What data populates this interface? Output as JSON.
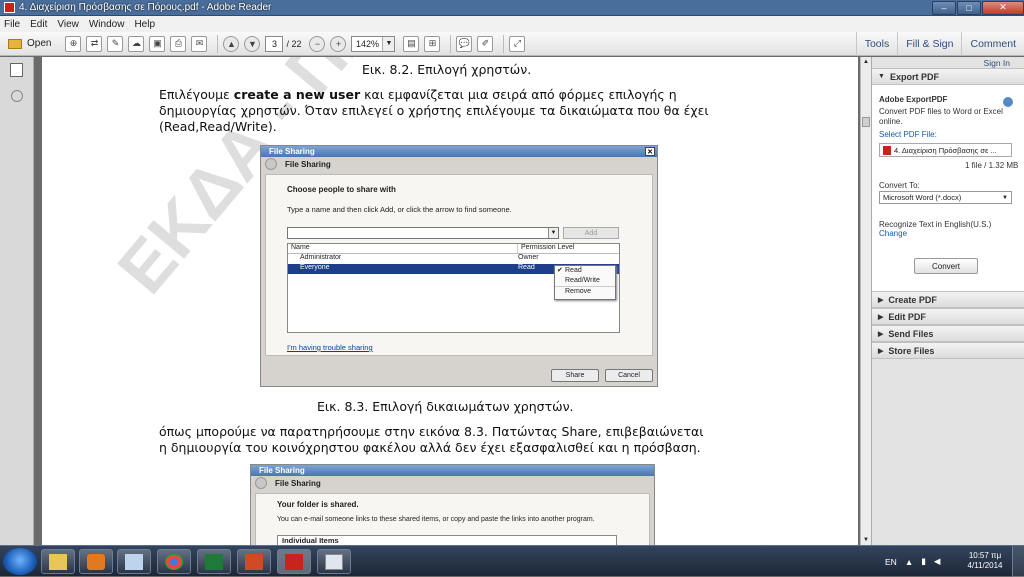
{
  "window": {
    "title": "4. Διαχείριση Πρόσβασης σε Πόρους.pdf - Adobe Reader",
    "min": "–",
    "max": "□",
    "close": "✕"
  },
  "menu": [
    "File",
    "Edit",
    "View",
    "Window",
    "Help"
  ],
  "toolbar": {
    "open_label": "Open",
    "page_current": "3",
    "page_total": "/ 22",
    "zoom": "142%",
    "tools": "Tools",
    "fill_sign": "Fill & Sign",
    "comment": "Comment"
  },
  "document": {
    "caption1": "Εικ. 8.2. Επιλογή χρηστών.",
    "para1_line1_pre": "Επιλέγουμε ",
    "para1_line1_bold": "create a new user",
    "para1_line1_post": " και εμφανίζεται  μια σειρά από φόρμες επιλογής η",
    "para1_line2": "δημιουργίας χρηστών. Όταν επιλεγεί ο χρήστης επιλέγουμε τα δικαιώματα που θα έχει",
    "para1_line3": "(Read,Read/Write).",
    "caption2": "Εικ. 8.3. Επιλογή δικαιωμάτων χρηστών.",
    "para2_line1": "όπως μπορούμε να παρατηρήσουμε στην εικόνα 8.3. Πατώντας Share, επιβεβαιώνεται",
    "para2_line2": "η δημιουργία του κοινόχρηστου φακέλου αλλά δεν έχει εξασφαλισθεί και η πρόσβαση.",
    "watermark": "ΕΚΔΑ - ΠΑΝΕΠΙΣΤΗΜΙΟ"
  },
  "dialog1": {
    "title": "File Sharing",
    "nav_title": "File Sharing",
    "heading": "Choose people to share with",
    "instructions": "Type a name and then click Add, or click the arrow to find someone.",
    "add_button": "Add",
    "col_name": "Name",
    "col_permission": "Permission Level",
    "rows": [
      {
        "name": "Administrator",
        "permission": "Owner"
      },
      {
        "name": "Everyone",
        "permission": "Read"
      }
    ],
    "menu_items": [
      "Read",
      "Read/Write",
      "Remove"
    ],
    "menu_check": "✔",
    "trouble_link": "I'm having trouble sharing",
    "share_button": "Share",
    "cancel_button": "Cancel"
  },
  "dialog2": {
    "title": "File Sharing",
    "nav_title": "File Sharing",
    "heading": "Your folder is shared.",
    "line": "You can e-mail someone links to these shared items, or copy and paste the links into another program.",
    "items_header": "Individual Items"
  },
  "right_panel": {
    "sign_in": "Sign In",
    "export_pdf": "Export PDF",
    "adobe_export": "Adobe ExportPDF",
    "convert_desc": "Convert PDF files to Word or Excel online.",
    "select_label": "Select PDF File:",
    "file_name": "4. Διαχείριση Πρόσβασης σε ...",
    "file_info": "1 file / 1.32 MB",
    "convert_to": "Convert To:",
    "format": "Microsoft Word (*.docx)",
    "recognize": "Recognize Text in English(U.S.)",
    "change": "Change",
    "convert_button": "Convert",
    "sections": [
      "Create PDF",
      "Edit PDF",
      "Send Files",
      "Store Files"
    ]
  },
  "taskbar": {
    "lang": "EN",
    "time": "10:57 πμ",
    "date": "4/11/2014"
  },
  "colors": {
    "accent": "#2f4f7a",
    "link": "#1a56a8",
    "selection": "#1d3f8a",
    "pdf_red": "#c9231b"
  },
  "icons": [
    "save-icon",
    "print-icon",
    "mail-icon",
    "page-up-icon",
    "page-down-icon",
    "zoom-out-icon",
    "zoom-in-icon",
    "fit-page-icon",
    "comment-icon",
    "highlight-icon",
    "fullscreen-icon"
  ]
}
